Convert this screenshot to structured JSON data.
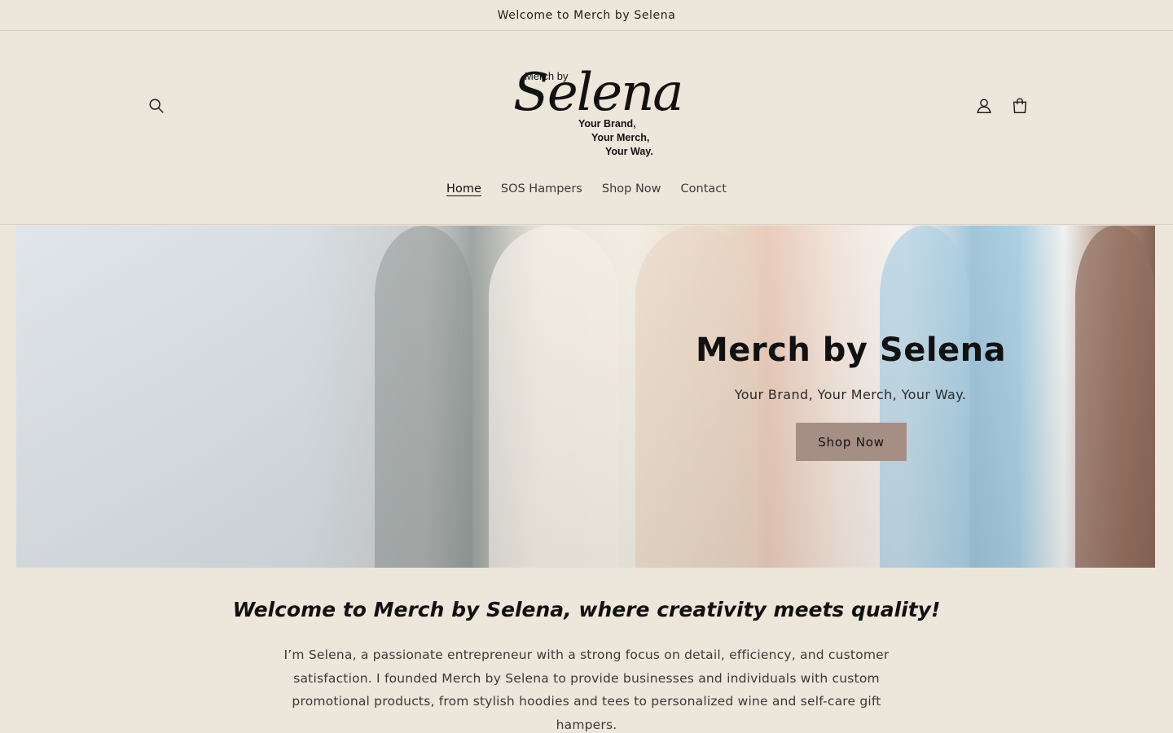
{
  "announcement": {
    "text": "Welcome to Merch by Selena"
  },
  "header": {
    "logo": {
      "small": "Merch by",
      "script": "Selena",
      "tagline": [
        "Your Brand,",
        "Your Merch,",
        "Your Way."
      ]
    },
    "icons": {
      "search": "search-icon",
      "account": "user-icon",
      "cart": "bag-icon"
    },
    "nav": [
      {
        "label": "Home",
        "active": true
      },
      {
        "label": "SOS Hampers",
        "active": false
      },
      {
        "label": "Shop Now",
        "active": false
      },
      {
        "label": "Contact",
        "active": false
      }
    ]
  },
  "hero": {
    "title": "Merch by Selena",
    "subtitle": "Your Brand, Your Merch, Your Way.",
    "button_label": "Shop Now",
    "button_color": "#a58f85"
  },
  "intro": {
    "heading": "Welcome to Merch by Selena, where creativity meets quality!",
    "body": "I’m Selena, a passionate entrepreneur with a strong focus on detail, efficiency, and customer satisfaction. I founded Merch by Selena to provide businesses and individuals with custom promotional products, from stylish hoodies and tees to personalized wine and self-care gift hampers."
  },
  "colors": {
    "background": "#ede6db",
    "border": "#d8d0c4",
    "text": "#1e1e1e"
  }
}
